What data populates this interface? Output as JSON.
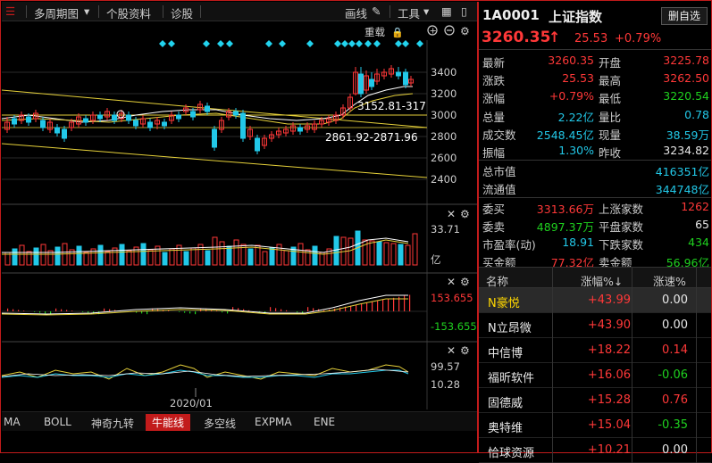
{
  "toolbar": {
    "multi_period": "多周期图",
    "stock_info": "个股资料",
    "diagnose": "诊股",
    "draw_line": "画线",
    "tools": "工具"
  },
  "main_chart": {
    "restore_label": "重载",
    "y_ticks": [
      "3400",
      "3200",
      "3000",
      "2800",
      "2600",
      "2400"
    ],
    "annotation_high": "3152.81-317",
    "annotation_low": "2861.92-2871.96"
  },
  "volume_panel": {
    "max_label": "33.71",
    "unit_label": "亿"
  },
  "macd_panel": {
    "max_label": "153.655",
    "min_label": "-153.655"
  },
  "kdj_panel": {
    "max_label": "99.57",
    "min_label": "10.28",
    "date_label": "2020/01"
  },
  "bottom_tabs": [
    "MA",
    "BOLL",
    "神奇九转",
    "牛能线",
    "多空线",
    "EXPMA",
    "ENE"
  ],
  "active_tab": "牛能线",
  "quote": {
    "code": "1A0001",
    "name": "上证指数",
    "add_watch": "删自选",
    "price": "3260.35",
    "arrow": "↑",
    "change": "25.53",
    "change_pct": "+0.79%",
    "fields": [
      {
        "l1": "最新",
        "v1": "3260.35",
        "c1": "red",
        "l2": "开盘",
        "v2": "3225.78",
        "c2": "red"
      },
      {
        "l1": "涨跌",
        "v1": "25.53",
        "c1": "red",
        "l2": "最高",
        "v2": "3262.50",
        "c2": "red"
      },
      {
        "l1": "涨幅",
        "v1": "+0.79%",
        "c1": "red",
        "l2": "最低",
        "v2": "3220.54",
        "c2": "green"
      },
      {
        "l1": "总量",
        "v1": "2.22亿",
        "c1": "cyan",
        "l2": "量比",
        "v2": "0.78",
        "c2": "cyan"
      },
      {
        "l1": "成交数",
        "v1": "2548.45亿",
        "c1": "cyan",
        "l2": "现量",
        "v2": "38.59万",
        "c2": "cyan"
      },
      {
        "l1": "振幅",
        "v1": "1.30%",
        "c1": "cyan",
        "l2": "昨收",
        "v2": "3234.82",
        "c2": "white"
      }
    ],
    "wide_fields": [
      {
        "l1": "总市值",
        "v1": "416351亿",
        "c1": "cyan"
      },
      {
        "l1": "流通值",
        "v1": "344748亿",
        "c1": "cyan"
      }
    ],
    "fields2": [
      {
        "l1": "委买",
        "v1": "3313.66万",
        "c1": "red",
        "l2": "上涨家数",
        "v2": "1262",
        "c2": "red"
      },
      {
        "l1": "委卖",
        "v1": "4897.37万",
        "c1": "green",
        "l2": "平盘家数",
        "v2": "65",
        "c2": "white"
      },
      {
        "l1": "市盈率(动)",
        "v1": "18.91",
        "c1": "cyan",
        "l2": "下跌家数",
        "v2": "434",
        "c2": "green"
      },
      {
        "l1": "买金额",
        "v1": "77.32亿",
        "c1": "red",
        "l2": "卖金额",
        "v2": "56.96亿",
        "c2": "green"
      }
    ]
  },
  "stock_list": {
    "headers": [
      "名称",
      "涨幅%↓",
      "涨速%"
    ],
    "rows": [
      {
        "name": "N豪悦",
        "pct": "+43.99",
        "speed": "0.00",
        "speed_color": "white"
      },
      {
        "name": "N立昂微",
        "pct": "+43.90",
        "speed": "0.00",
        "speed_color": "white"
      },
      {
        "name": "中信博",
        "pct": "+18.22",
        "speed": "0.14",
        "speed_color": "red"
      },
      {
        "name": "福昕软件",
        "pct": "+16.06",
        "speed": "-0.06",
        "speed_color": "green"
      },
      {
        "name": "固德威",
        "pct": "+15.28",
        "speed": "0.76",
        "speed_color": "red"
      },
      {
        "name": "奥特维",
        "pct": "+15.04",
        "speed": "-0.35",
        "speed_color": "green"
      },
      {
        "name": "恰球资源",
        "pct": "+10.21",
        "speed": "0.00",
        "speed_color": "white"
      }
    ]
  }
}
